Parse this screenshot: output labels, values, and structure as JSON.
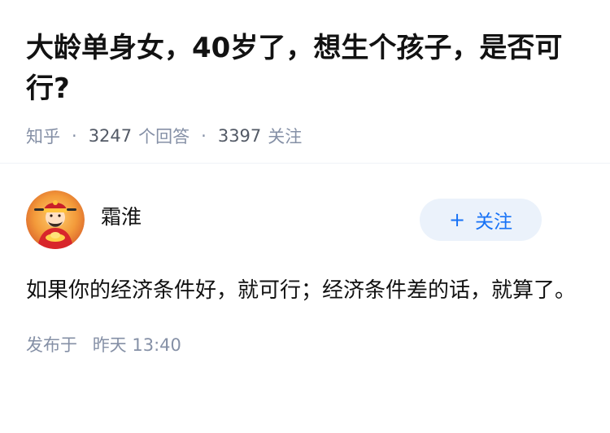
{
  "question": {
    "title": "大龄单身女，40岁了，想生个孩子，是否可行?",
    "source": "知乎",
    "answers_count": "3247",
    "answers_label": "个回答",
    "followers_count": "3397",
    "followers_label": "关注",
    "separator": "·"
  },
  "answer": {
    "author_name": "霜淮",
    "follow_label": "关注",
    "follow_plus": "+",
    "content": "如果你的经济条件好，就可行；经济条件差的话，就算了。",
    "published_label": "发布于",
    "published_time": "昨天 13:40"
  },
  "colors": {
    "accent": "#1772f6",
    "follow_bg": "#ebf2fb",
    "meta_gray": "#8590a6"
  }
}
